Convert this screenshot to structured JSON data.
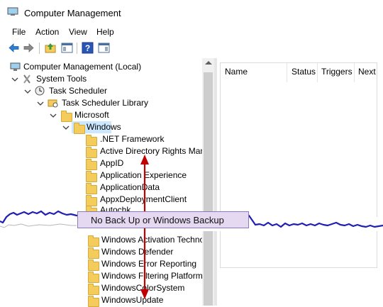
{
  "window": {
    "title": "Computer Management"
  },
  "menu": {
    "file": "File",
    "action": "Action",
    "view": "View",
    "help": "Help"
  },
  "tree": {
    "root": "Computer Management (Local)",
    "system_tools": "System Tools",
    "task_scheduler": "Task Scheduler",
    "task_scheduler_library": "Task Scheduler Library",
    "microsoft": "Microsoft",
    "windows": "Windows",
    "folders_top": [
      ".NET Framework",
      "Active Directory Rights Mana",
      "AppID",
      "Application Experience",
      "ApplicationData",
      "AppxDeploymentClient",
      "Autochk"
    ],
    "folders_bottom": [
      "Windows Activation Technolo",
      "Windows Defender",
      "Windows Error Reporting",
      "Windows Filtering Platform",
      "WindowsColorSystem",
      "WindowsUpdate"
    ]
  },
  "list_columns": {
    "name": "Name",
    "status": "Status",
    "triggers": "Triggers",
    "next": "Next"
  },
  "annotation": {
    "callout_text": "No Back Up or Windows Backup"
  },
  "colors": {
    "selection": "#cce8ff",
    "arrow": "#c00000",
    "torn_edge": "#1f1fb4",
    "callout_bg": "#e5d9f2"
  }
}
